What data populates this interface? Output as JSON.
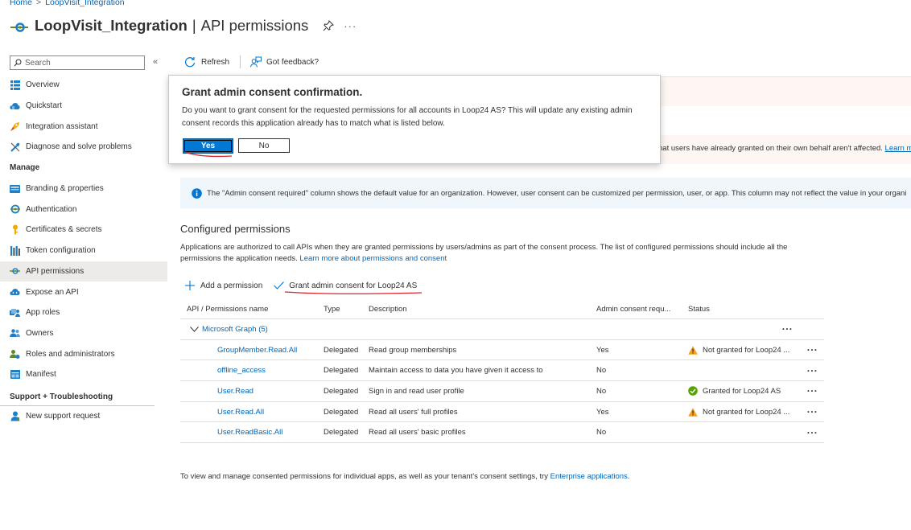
{
  "breadcrumb": {
    "home": "Home",
    "current": "LoopVisit_Integration"
  },
  "header": {
    "app_name": "LoopVisit_Integration",
    "separator": "|",
    "page": "API permissions",
    "more": "···"
  },
  "search": {
    "placeholder": "Search"
  },
  "sidebar": {
    "top_items": [
      {
        "label": "Overview",
        "icon": "overview-icon"
      },
      {
        "label": "Quickstart",
        "icon": "quickstart-cloud-icon"
      },
      {
        "label": "Integration assistant",
        "icon": "rocket-icon"
      },
      {
        "label": "Diagnose and solve problems",
        "icon": "wrench-icon"
      }
    ],
    "manage_header": "Manage",
    "manage_items": [
      {
        "label": "Branding & properties",
        "icon": "branding-icon"
      },
      {
        "label": "Authentication",
        "icon": "authentication-icon"
      },
      {
        "label": "Certificates & secrets",
        "icon": "key-icon"
      },
      {
        "label": "Token configuration",
        "icon": "token-bars-icon"
      },
      {
        "label": "API permissions",
        "icon": "api-permissions-icon",
        "active": true
      },
      {
        "label": "Expose an API",
        "icon": "cloud-api-icon"
      },
      {
        "label": "App roles",
        "icon": "app-roles-icon"
      },
      {
        "label": "Owners",
        "icon": "owners-icon"
      },
      {
        "label": "Roles and administrators",
        "icon": "roles-admin-icon"
      },
      {
        "label": "Manifest",
        "icon": "manifest-icon"
      }
    ],
    "support_header": "Support + Troubleshooting",
    "support_items": [
      {
        "label": "New support request",
        "icon": "support-person-icon"
      }
    ]
  },
  "toolbar": {
    "refresh": "Refresh",
    "feedback": "Got feedback?"
  },
  "warning_banner": {
    "text": "hat users have already granted on their own behalf aren't affected.",
    "link": "Learn m"
  },
  "info_banner": {
    "text": "The \"Admin consent required\" column shows the default value for an organization. However, user consent can be customized per permission, user, or app. This column may not reflect the value in your organi"
  },
  "configured": {
    "heading": "Configured permissions",
    "description": "Applications are authorized to call APIs when they are granted permissions by users/admins as part of the consent process. The list of configured permissions should include all the permissions the application needs.",
    "learn_more": "Learn more about permissions and consent",
    "add_permission": "Add a permission",
    "grant_consent": "Grant admin consent for Loop24 AS"
  },
  "table": {
    "headers": {
      "name": "API / Permissions name",
      "type": "Type",
      "description": "Description",
      "admin": "Admin consent requ...",
      "status": "Status"
    },
    "group": "Microsoft Graph (5)",
    "rows": [
      {
        "name": "GroupMember.Read.All",
        "type": "Delegated",
        "description": "Read group memberships",
        "admin": "Yes",
        "status": "Not granted for Loop24 ...",
        "status_kind": "warning"
      },
      {
        "name": "offline_access",
        "type": "Delegated",
        "description": "Maintain access to data you have given it access to",
        "admin": "No",
        "status": "",
        "status_kind": "none"
      },
      {
        "name": "User.Read",
        "type": "Delegated",
        "description": "Sign in and read user profile",
        "admin": "No",
        "status": "Granted for Loop24 AS",
        "status_kind": "granted"
      },
      {
        "name": "User.Read.All",
        "type": "Delegated",
        "description": "Read all users' full profiles",
        "admin": "Yes",
        "status": "Not granted for Loop24 ...",
        "status_kind": "warning"
      },
      {
        "name": "User.ReadBasic.All",
        "type": "Delegated",
        "description": "Read all users' basic profiles",
        "admin": "No",
        "status": "",
        "status_kind": "none"
      }
    ],
    "more": "···"
  },
  "footer": {
    "text": "To view and manage consented permissions for individual apps, as well as your tenant's consent settings, try",
    "link": "Enterprise applications",
    "end": "."
  },
  "modal": {
    "title": "Grant admin consent confirmation.",
    "text": "Do you want to grant consent for the requested permissions for all accounts in Loop24 AS? This will update any existing admin consent records this application already has to match what is listed below.",
    "yes": "Yes",
    "no": "No"
  },
  "colors": {
    "accent": "#0078d4",
    "link": "#0067b8",
    "warning": "#f7a01b",
    "success": "#57a300",
    "annotation": "#d9252c"
  }
}
